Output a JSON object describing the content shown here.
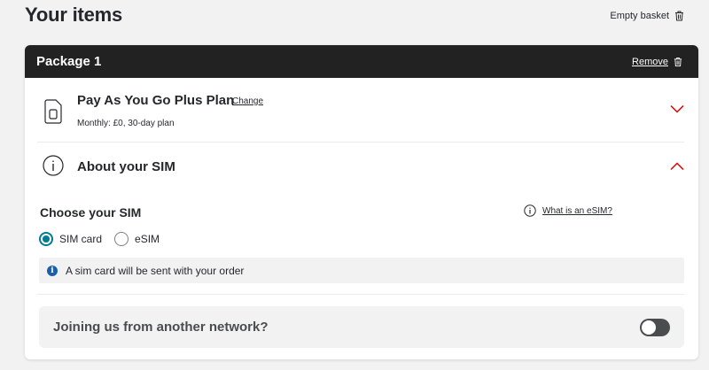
{
  "page": {
    "title": "Your items",
    "empty_basket_label": "Empty basket"
  },
  "package": {
    "title": "Package 1",
    "remove_label": "Remove"
  },
  "plan": {
    "name": "Pay As You Go Plus Plan",
    "change_label": "Change",
    "subtitle": "Monthly: £0, 30-day plan"
  },
  "about_sim": {
    "title": "About your SIM"
  },
  "choose_sim": {
    "title": "Choose your SIM",
    "what_esim_label": "What is an eSIM?",
    "options": [
      "SIM card",
      "eSIM"
    ],
    "selected": "SIM card",
    "notice": "A sim card will be sent with your order"
  },
  "network": {
    "label": "Joining us from another network?",
    "toggle_on": false
  },
  "colors": {
    "header_bg": "#222222",
    "accent_red": "#e60000",
    "radio_teal": "#007c92",
    "info_blue": "#1b60a6"
  },
  "icons": [
    "trash-icon",
    "sim-card-icon",
    "chevron-down-icon",
    "info-circle-icon",
    "chevron-up-icon"
  ]
}
